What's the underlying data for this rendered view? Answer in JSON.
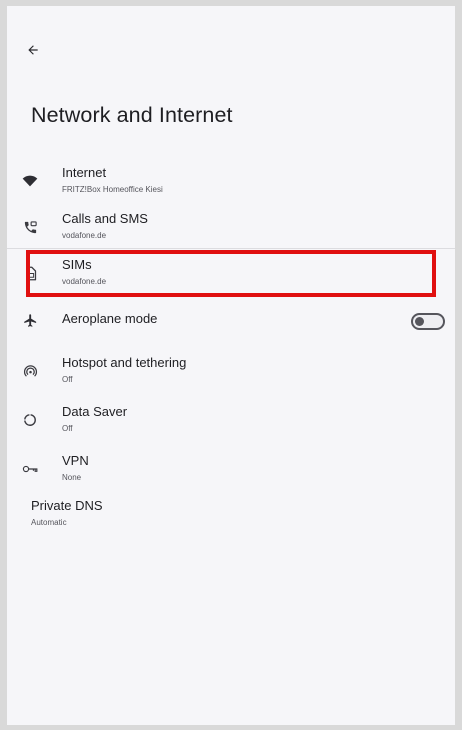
{
  "header": {
    "back_icon": "arrow-back-icon",
    "title": "Network and Internet"
  },
  "items": [
    {
      "icon": "wifi-icon",
      "title": "Internet",
      "subtitle": "FRITZ!Box Homeoffice Kiesi"
    },
    {
      "icon": "call-sms-icon",
      "title": "Calls and SMS",
      "subtitle": "vodafone.de"
    },
    {
      "icon": "sim-card-icon",
      "title": "SIMs",
      "subtitle": "vodafone.de"
    },
    {
      "icon": "airplane-icon",
      "title": "Aeroplane mode",
      "toggle_on": false
    },
    {
      "icon": "hotspot-icon",
      "title": "Hotspot and tethering",
      "subtitle": "Off"
    },
    {
      "icon": "data-saver-icon",
      "title": "Data Saver",
      "subtitle": "Off"
    },
    {
      "icon": "vpn-key-icon",
      "title": "VPN",
      "subtitle": "None"
    }
  ],
  "private_dns": {
    "title": "Private DNS",
    "subtitle": "Automatic"
  },
  "colors": {
    "highlight": "#e01010",
    "background": "#f6f6f9",
    "text": "#1e1e22"
  }
}
